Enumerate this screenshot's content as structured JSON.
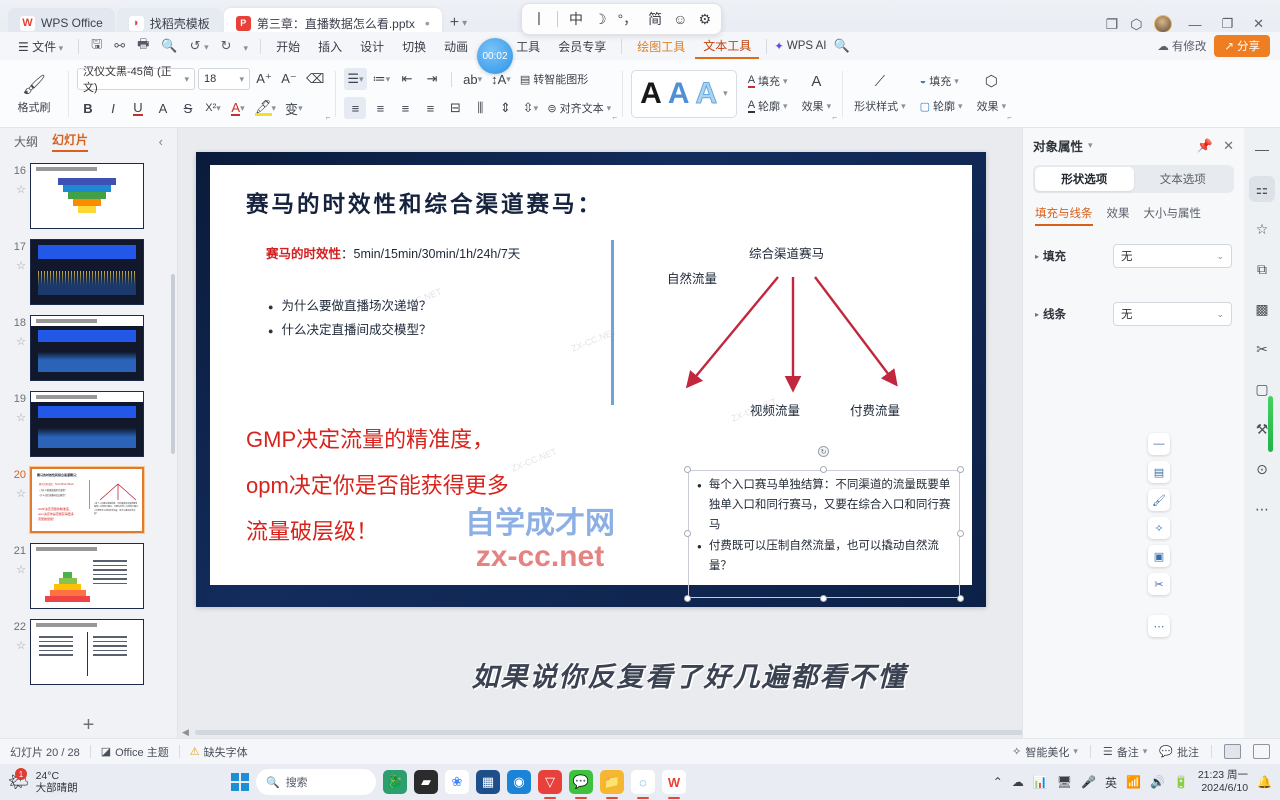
{
  "tabbar": {
    "tabs": [
      {
        "label": "WPS Office",
        "icon": "wps-logo-icon",
        "active": false
      },
      {
        "label": "找稻壳模板",
        "icon": "docer-icon",
        "active": false
      },
      {
        "label": "第三章：直播数据怎么看.pptx",
        "icon": "ppt-file-icon",
        "active": true
      }
    ],
    "new_tab": "+",
    "controls": {
      "minimize": "—",
      "maximize": "❐",
      "close": "✕"
    }
  },
  "ime_bar": {
    "items": [
      "丨",
      "中",
      "☽",
      "°，",
      "简",
      "☺",
      "⚙"
    ]
  },
  "menubar": {
    "file": "文件",
    "items": [
      "开始",
      "插入",
      "设计",
      "切换",
      "动画",
      "图",
      "工具",
      "会员专享"
    ],
    "tool_tabs": [
      {
        "label": "绘图工具",
        "active": false
      },
      {
        "label": "文本工具",
        "active": true
      }
    ],
    "wps_ai": "WPS AI",
    "modified": "有修改",
    "share": "分享",
    "recording_time": "00:02"
  },
  "ribbon": {
    "format_painter": "格式刷",
    "font_name": "汉仪文黑-45简 (正文)",
    "font_size": "18",
    "grow": "A⁺",
    "shrink": "A⁻",
    "clear_format": "⌫",
    "bold": "B",
    "italic": "I",
    "underline": "U",
    "strike_a": "A",
    "strike_s": "S",
    "superscript": "X²",
    "font_color": "A",
    "highlight": "✎",
    "text_effect": "变",
    "smart_graphic": "转智能图形",
    "align_text": "对齐文本",
    "wordart": [
      "A",
      "A",
      "A"
    ],
    "text_fill": "填充",
    "text_outline": "轮廓",
    "text_effects": "效果",
    "shape_style": "形状样式",
    "shape_fill": "填充",
    "shape_outline": "轮廓",
    "shape_effects": "效果"
  },
  "thumbnails": {
    "tab_outline": "大纲",
    "tab_slides": "幻灯片",
    "collapse": "‹",
    "add": "+",
    "slides": [
      {
        "num": "16",
        "type": "funnel",
        "selected": false
      },
      {
        "num": "17",
        "type": "dashboard-gold",
        "selected": false
      },
      {
        "num": "18",
        "type": "dashboard-blue",
        "selected": false
      },
      {
        "num": "19",
        "type": "dashboard-blue2",
        "selected": false
      },
      {
        "num": "20",
        "type": "current-slide",
        "selected": true
      },
      {
        "num": "21",
        "type": "pyramid",
        "selected": false
      },
      {
        "num": "22",
        "type": "two-column-text",
        "selected": false
      }
    ]
  },
  "slide": {
    "title": "赛马的时效性和综合渠道赛马：",
    "subtitle_label": "赛马的时效性",
    "subtitle_value": "：5min/15min/30min/1h/24h/7天",
    "bullets": [
      "为什么要做直播场次递增？",
      "什么决定直播间成交模型？"
    ],
    "diagram": {
      "top": "综合渠道赛马",
      "leaves": [
        "自然流量",
        "视频流量",
        "付费流量"
      ]
    },
    "red_text": [
      "GMP决定流量的精准度，",
      "opm决定你是否能获得更多",
      "流量破层级！"
    ],
    "watermark_blue": "自学成才网",
    "watermark_red": "zx-cc.net",
    "watermark_faint": "ZX-CC.NET",
    "selected_textbox": {
      "bullets": [
        "每个入口赛马单独结算：不同渠道的流量既要单独单入口和同行赛马，又要在综合入口和同行赛马",
        "付费既可以压制自然流量，也可以撬动自然流量？"
      ]
    }
  },
  "caption": "如果说你反复看了好几遍都看不懂",
  "properties_panel": {
    "title": "对象属性",
    "pin": "📌",
    "close": "✕",
    "segments": [
      {
        "label": "形状选项",
        "active": true
      },
      {
        "label": "文本选项",
        "active": false
      }
    ],
    "subtabs": [
      {
        "label": "填充与线条",
        "active": true
      },
      {
        "label": "效果",
        "active": false
      },
      {
        "label": "大小与属性",
        "active": false
      }
    ],
    "rows": [
      {
        "label": "填充",
        "value": "无"
      },
      {
        "label": "线条",
        "value": "无"
      }
    ]
  },
  "rail": {
    "icons": [
      "minimize-rail-icon",
      "properties-icon",
      "star-icon",
      "duplicate-icon",
      "resources-icon",
      "magic-icon",
      "screenshot-icon",
      "toolkit-icon",
      "help-icon",
      "more-icon"
    ]
  },
  "canvas_float_icons": [
    "minus-icon",
    "layers-icon",
    "brush-icon",
    "eyedropper-icon",
    "frame-icon",
    "magic-wand-icon",
    "more-dots-icon"
  ],
  "status": {
    "slide_counter": "幻灯片 20 / 28",
    "theme": "Office 主题",
    "missing_font": "缺失字体",
    "beautify": "智能美化",
    "notes": "备注",
    "comments": "批注"
  },
  "taskbar": {
    "weather_temp": "24°C",
    "weather_desc": "大部晴朗",
    "weather_badge": "1",
    "search_placeholder": "搜索",
    "clock_time": "21:23 周一",
    "clock_date": "2024/6/10",
    "language": "英"
  },
  "colors": {
    "accent_orange": "#d9601c",
    "share_orange": "#ef7d22",
    "slide_red": "#d8231c",
    "arrow_red": "#c1283d",
    "slide_navy": "#132c5c"
  }
}
